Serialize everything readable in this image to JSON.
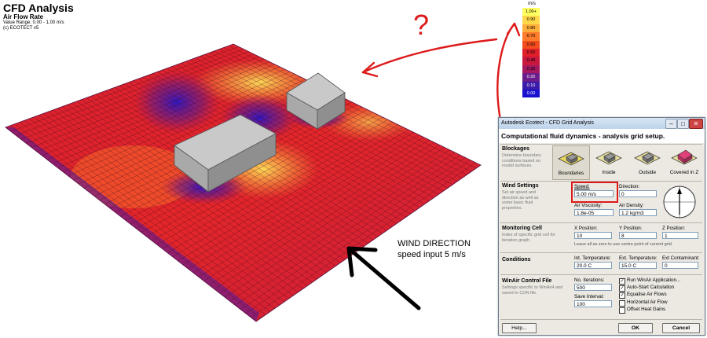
{
  "header": {
    "title": "CFD Analysis",
    "subtitle": "Air Flow Rate",
    "value_range": "Value Range: 0.00 - 1.00 m/s",
    "copyright": "(c) ECOTECT v5"
  },
  "legend": {
    "unit": "m/s",
    "items": [
      {
        "label": "1.00+",
        "color": "#ffff60"
      },
      {
        "label": "0.90",
        "color": "#ffd84a"
      },
      {
        "label": "0.80",
        "color": "#ffad3a"
      },
      {
        "label": "0.70",
        "color": "#ff7a2a"
      },
      {
        "label": "0.60",
        "color": "#f24c1e"
      },
      {
        "label": "0.50",
        "color": "#e01f2a"
      },
      {
        "label": "0.40",
        "color": "#c9183e"
      },
      {
        "label": "0.30",
        "color": "#a51860"
      },
      {
        "label": "0.20",
        "color": "#6a1c8a"
      },
      {
        "label": "0.10",
        "color": "#3a1aa8"
      },
      {
        "label": "0.00",
        "color": "#1a10d0"
      }
    ]
  },
  "annotation": {
    "question_mark": "?",
    "wind_direction": "WIND DIRECTION",
    "speed_input": "speed input 5 m/s",
    "annotation_color": "#dd1a1a"
  },
  "dialog": {
    "title": "Autodesk Ecotect - CFD Grid Analysis",
    "controls": {
      "minimize": "–",
      "maximize": "□",
      "close": "✕"
    },
    "header": "Computational fluid dynamics - analysis grid setup.",
    "blockages": {
      "title": "Blockages",
      "description": "Determine boundary conditions based on model surfaces.",
      "options": [
        {
          "label": "Boundaries",
          "icon": "boundaries-icon",
          "selected": true
        },
        {
          "label": "Inside",
          "icon": "inside-icon",
          "selected": false
        },
        {
          "label": "Outside",
          "icon": "outside-icon",
          "selected": false
        },
        {
          "label": "Covered in Z",
          "icon": "covered-in-z-icon",
          "selected": false
        }
      ]
    },
    "wind": {
      "title": "Wind Settings",
      "description": "Set air speed and direction as well as some basic fluid properties.",
      "speed_label": "Speed:",
      "speed_value": "5.00 m/s",
      "direction_label": "Direction:",
      "direction_value": "0",
      "viscosity_label": "Air Viscosity:",
      "viscosity_value": "1.8e-05",
      "density_label": "Air Density:",
      "density_value": "1.2 kg/m3"
    },
    "monitoring": {
      "title": "Monitoring Cell",
      "description": "Index of specific grid cell for iteration graph.",
      "x_label": "X Position:",
      "x_value": "10",
      "y_label": "Y Position:",
      "y_value": "8",
      "z_label": "Z Position:",
      "z_value": "1",
      "hint": "Leave all as zero to use centre point of current grid."
    },
    "conditions": {
      "title": "Conditions",
      "int_temp_label": "Int. Temperature:",
      "int_temp_value": "20.0 C",
      "ext_temp_label": "Ext. Temperature:",
      "ext_temp_value": "15.0 C",
      "ext_contaminant_label": "Ext Contaminant:",
      "ext_contaminant_value": "0"
    },
    "winair": {
      "title": "WinAir Control File",
      "description": "Settings specific to WinAir4 and saved to CON file.",
      "iterations_label": "No. Iterations:",
      "iterations_value": "500",
      "save_interval_label": "Save Interval:",
      "save_interval_value": "100",
      "checkboxes": [
        {
          "label": "Run WinAir Application...",
          "checked": true
        },
        {
          "label": "Auto-Start Calculation",
          "checked": true
        },
        {
          "label": "Equalise Air Flows",
          "checked": true
        },
        {
          "label": "Horizontal Air Flow",
          "checked": false
        },
        {
          "label": "Offset Heat Gains",
          "checked": false
        }
      ]
    },
    "buttons": {
      "help": "Help...",
      "ok": "OK",
      "cancel": "Cancel"
    }
  }
}
